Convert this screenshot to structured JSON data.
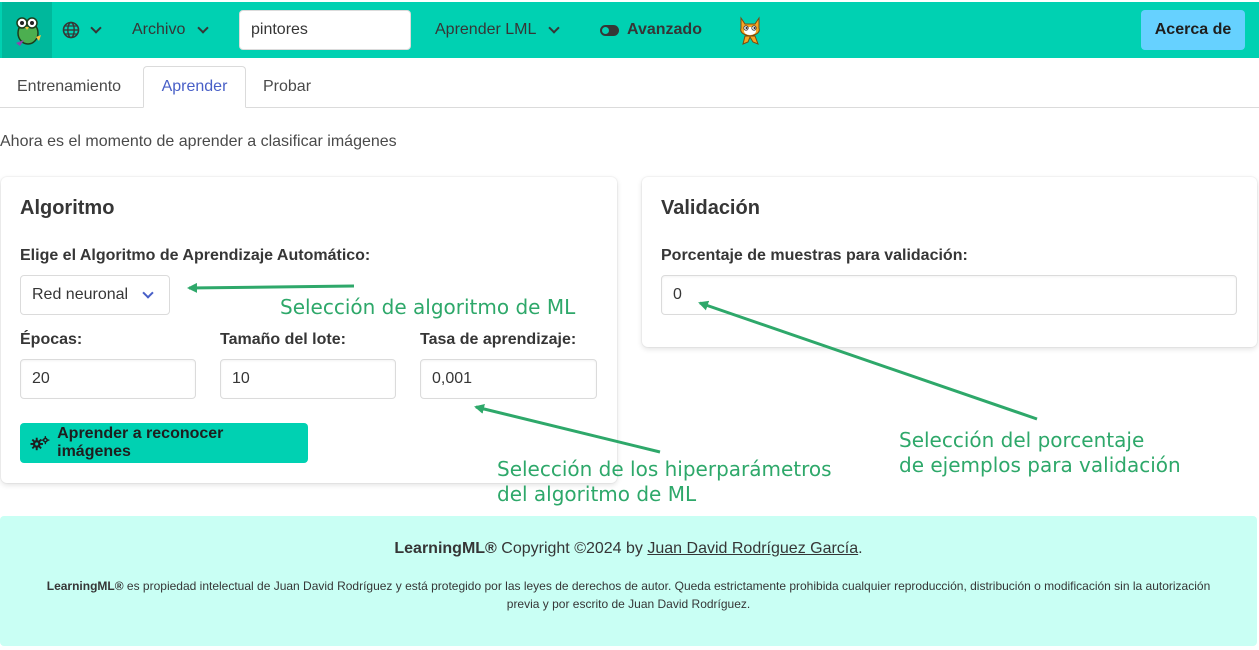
{
  "navbar": {
    "language_icon": "globe-icon",
    "file_menu": "Archivo",
    "project_name": "pintores",
    "learn_menu": "Aprender LML",
    "advanced_toggle": "Avanzado",
    "about_button": "Acerca de",
    "colors": {
      "bar": "#00d1b2",
      "about": "#66d1ff"
    }
  },
  "tabs": {
    "training": "Entrenamiento",
    "learn": "Aprender",
    "test": "Probar",
    "active": "Aprender"
  },
  "intro": "Ahora es el momento de aprender a clasificar imágenes",
  "algorithm": {
    "title": "Algoritmo",
    "choose_label": "Elige el Algoritmo de Aprendizaje Automático:",
    "selected": "Red neuronal",
    "epochs_label": "Épocas:",
    "epochs_value": "20",
    "batch_label": "Tamaño del lote:",
    "batch_value": "10",
    "lr_label": "Tasa de aprendizaje:",
    "lr_value": "0,001",
    "learn_button": "Aprender a reconocer imágenes"
  },
  "validation": {
    "title": "Validación",
    "percent_label": "Porcentaje de muestras para validación:",
    "percent_value": "0"
  },
  "annotations": {
    "algo": "Selección de algoritmo de ML",
    "hyper_line1": "Selección de los hiperparámetros",
    "hyper_line2": "del algoritmo de ML",
    "valid_line1": "Selección del porcentaje",
    "valid_line2": "de ejemplos para validación",
    "color": "#2ea86a"
  },
  "footer": {
    "brand": "LearningML®",
    "copyright": " Copyright ©2024 by ",
    "author": "Juan David Rodríguez García",
    "period": ".",
    "notice_brand": "LearningML®",
    "notice": " es propiedad intelectual de Juan David Rodríguez y está protegido por las leyes de derechos de autor. Queda estrictamente prohibida cualquier reproducción, distribución o modificación sin la autorización previa y por escrito de Juan David Rodríguez."
  }
}
